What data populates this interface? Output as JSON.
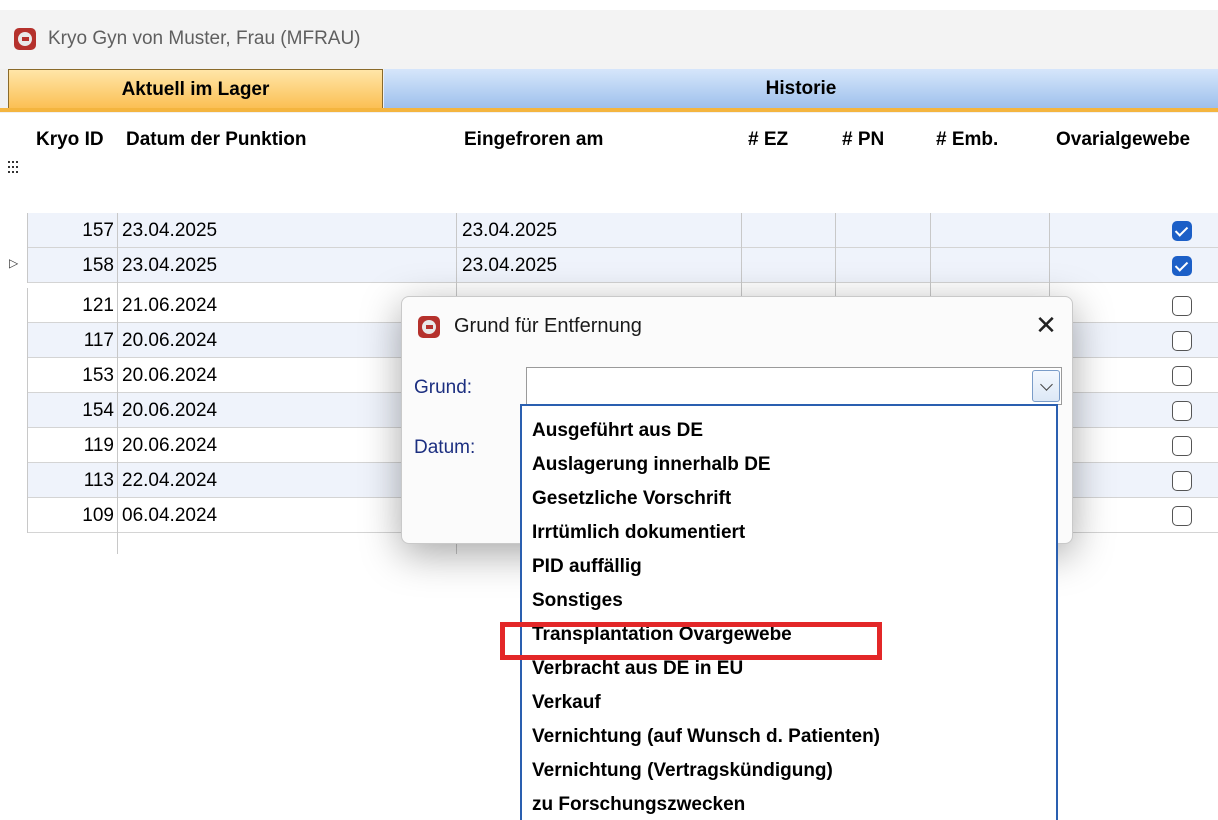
{
  "window": {
    "title": "Kryo Gyn von Muster, Frau (MFRAU)",
    "icon": "app-logo-icon"
  },
  "tabs": [
    {
      "label": "Aktuell im Lager",
      "active": true
    },
    {
      "label": "Historie",
      "active": false
    }
  ],
  "grid": {
    "columns": [
      "Kryo ID",
      "Datum der Punktion",
      "Eingefroren am",
      "# EZ",
      "# PN",
      "# Emb.",
      "Ovarialgewebe"
    ],
    "rows": [
      {
        "id": "157",
        "punktion": "23.04.2025",
        "eingefroren": "23.04.2025",
        "ovarialgewebe": true
      },
      {
        "id": "158",
        "punktion": "23.04.2025",
        "eingefroren": "23.04.2025",
        "ovarialgewebe": true,
        "current": true
      },
      {
        "id": "121",
        "punktion": "21.06.2024",
        "eingefroren": "",
        "ovarialgewebe": false
      },
      {
        "id": "117",
        "punktion": "20.06.2024",
        "eingefroren": "",
        "ovarialgewebe": false
      },
      {
        "id": "153",
        "punktion": "20.06.2024",
        "eingefroren": "",
        "ovarialgewebe": false
      },
      {
        "id": "154",
        "punktion": "20.06.2024",
        "eingefroren": "",
        "ovarialgewebe": false
      },
      {
        "id": "119",
        "punktion": "20.06.2024",
        "eingefroren": "",
        "ovarialgewebe": false
      },
      {
        "id": "113",
        "punktion": "22.04.2024",
        "eingefroren": "",
        "ovarialgewebe": false
      },
      {
        "id": "109",
        "punktion": "06.04.2024",
        "eingefroren": "",
        "ovarialgewebe": false
      }
    ]
  },
  "dialog": {
    "title": "Grund für Entfernung",
    "close": "✕",
    "grund_label": "Grund:",
    "datum_label": "Datum:",
    "grund_value": ""
  },
  "dropdown": {
    "options": [
      "Ausgeführt aus DE",
      "Auslagerung innerhalb DE",
      "Gesetzliche Vorschrift",
      "Irrtümlich dokumentiert",
      "PID auffällig",
      "Sonstiges",
      "Transplantation Ovargewebe",
      "Verbracht aus DE in EU",
      "Verkauf",
      "Vernichtung (auf Wunsch d. Patienten)",
      "Vernichtung (Vertragskündigung)",
      "zu Forschungszwecken"
    ],
    "highlighted": "Transplantation Ovargewebe"
  },
  "colors": {
    "highlight": "#e32728",
    "checkbox_on": "#1c5fc7",
    "tab_active": "#fbbf52",
    "tab_inactive": "#9ec0ec"
  }
}
